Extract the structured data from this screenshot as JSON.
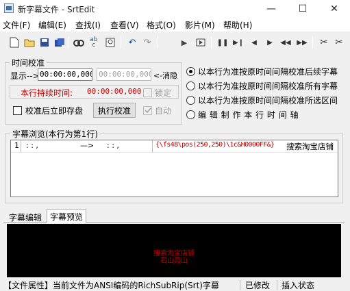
{
  "window": {
    "title": "新字幕文件 - SrtEdit",
    "minimize": "—",
    "maximize": "☐",
    "close": "✕"
  },
  "menu": [
    "文件(F)",
    "编辑(E)",
    "查找(I)",
    "查看(V)",
    "格式(O)",
    "影片(M)",
    "帮助(H)"
  ],
  "toolbar": {
    "icons": [
      "new-file-icon",
      "open-folder-icon",
      "save-icon",
      "save-all-icon",
      "find-icon",
      "spell-check-icon",
      "preview-icon",
      "undo-icon",
      "redo-icon",
      "play-icon",
      "play-frame-icon",
      "pause-icon",
      "next-icon",
      "arrow-left-icon",
      "arrow-right-icon",
      "rewind-icon",
      "fast-forward-icon",
      "mark-start-icon",
      "mark-end-icon"
    ]
  },
  "timing": {
    "group_title": "时间校准",
    "display_label": "显示-->",
    "display_start": "00:00:00,000",
    "display_end": "00:00:00,000",
    "cancel_label": "<-消隐",
    "duration_label": "本行持续时间:",
    "duration_value": "00:00:00,000",
    "lock_label": "锁定",
    "save_after_label": "校准后立即存盘",
    "execute_button": "执行校准",
    "auto_label": "自动",
    "options": [
      "以本行为准按原时间间隔校准后续字幕",
      "以本行为准按原时间间隔校准所有字幕",
      "以本行为准按原时间间隔校准所选区间",
      "编 辑 制 作 本 行 时 间 轴"
    ],
    "selected_option": 0
  },
  "browser": {
    "group_title": "字幕浏览(本行为第1行)",
    "row": {
      "index": "1",
      "start": ":  :  ,",
      "arrow": "—>",
      "end": ":  :  ,",
      "tag": "{\\fs48\\pos(250,250)\\1c&H0000FF&}",
      "text": "搜索淘宝店铺"
    }
  },
  "tabs": {
    "edit": "字幕编辑",
    "preview": "字幕预览"
  },
  "preview": {
    "line1": "搜索淘宝店铺",
    "line2": "石山霞山"
  },
  "status": {
    "file_info": "【文件属性】当前文件为ANSI编码的RichSubRip(Srt)字幕",
    "modified": "已修改",
    "insert_mode": "插入状态"
  }
}
